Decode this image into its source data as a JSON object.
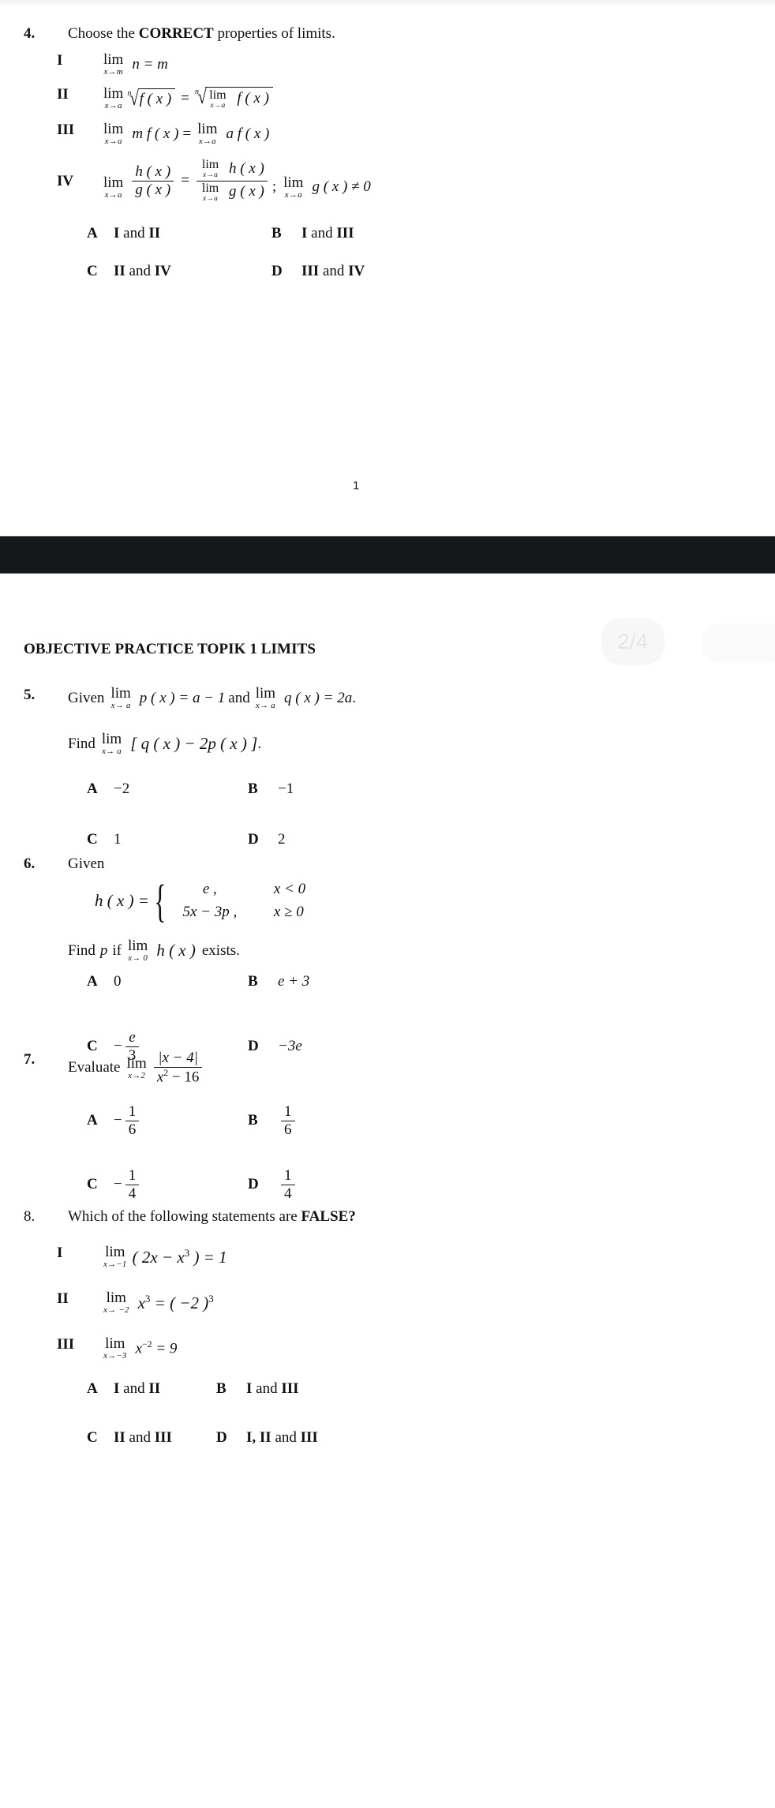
{
  "document": {
    "title": "OBJECTIVE PRACTICE TOPIK 1 LIMITS",
    "page_footer_number": "1"
  },
  "viewer": {
    "page_indicator": "2/4"
  },
  "questions": [
    {
      "number": "4.",
      "prompt_pre": "Choose the ",
      "prompt_bold": "CORRECT",
      "prompt_post": " properties of limits.",
      "statements": [
        {
          "roman": "I",
          "lim_op": "lim",
          "lim_sub": "x→m",
          "body": "n = m"
        },
        {
          "roman": "II",
          "lim_op": "lim",
          "lim_sub": "x→a",
          "root_index": "n",
          "inner": "f ( x )",
          "equals": "=",
          "rhs_root_index": "n",
          "rhs_lim_op": "lim",
          "rhs_lim_sub": "x→a",
          "rhs_inner": "f ( x )"
        },
        {
          "roman": "III",
          "lim_op": "lim",
          "lim_sub": "x→a",
          "lhs": "m f ( x )",
          "equals": "=",
          "rhs_lim_op": "lim",
          "rhs_lim_sub": "x→a",
          "rhs": "a f ( x )"
        },
        {
          "roman": "IV",
          "lim_op": "lim",
          "lim_sub": "x→a",
          "num": "h ( x )",
          "den": "g ( x )",
          "equals": "=",
          "rhs_num_lim": "lim",
          "rhs_num_sub": "x→a",
          "rhs_num": "h ( x )",
          "rhs_den_lim": "lim",
          "rhs_den_sub": "x→a",
          "rhs_den": "g ( x )",
          "semicolon": ";",
          "cond_lim": "lim",
          "cond_sub": "x→a",
          "cond": "g ( x ) ≠ 0"
        }
      ],
      "options": [
        {
          "label": "A",
          "pre": "",
          "bold1": "I",
          "mid": " and ",
          "bold2": "II"
        },
        {
          "label": "B",
          "pre": "",
          "bold1": "I",
          "mid": " and ",
          "bold2": "III"
        },
        {
          "label": "C",
          "pre": "",
          "bold1": "II",
          "mid": " and ",
          "bold2": "IV"
        },
        {
          "label": "D",
          "pre": "",
          "bold1": "III",
          "mid": " and ",
          "bold2": "IV"
        }
      ]
    },
    {
      "number": "5.",
      "given_word": "Given",
      "lim1_op": "lim",
      "lim1_sub": "x→ a",
      "expr1": "p ( x ) = a − 1",
      "and_word": " and ",
      "lim2_op": "lim",
      "lim2_sub": "x→ a",
      "expr2": "q ( x ) = 2a",
      "period1": ".",
      "find_word": "Find",
      "lim3_op": "lim",
      "lim3_sub": "x→ a",
      "expr3": "[ q ( x ) − 2p ( x ) ]",
      "period2": ".",
      "options": [
        {
          "label": "A",
          "value": "−2"
        },
        {
          "label": "B",
          "value": "−1"
        },
        {
          "label": "C",
          "value": "1"
        },
        {
          "label": "D",
          "value": "2"
        }
      ]
    },
    {
      "number": "6.",
      "given_word": "Given",
      "fn_name": "h ( x ) =",
      "piece_rows": [
        {
          "expr": "e ,",
          "cond": "x < 0"
        },
        {
          "expr": "5x − 3p ,",
          "cond": "x ≥ 0"
        }
      ],
      "find_pre": "Find",
      "find_var": "p",
      "find_mid": "if",
      "lim_op": "lim",
      "lim_sub": "x→ 0",
      "find_fn": "h ( x )",
      "find_post": "exists.",
      "options": [
        {
          "label": "A",
          "value": "0"
        },
        {
          "label": "B",
          "value": "e + 3"
        },
        {
          "label": "C",
          "value": "fraction:-e/3"
        },
        {
          "label": "D",
          "value": "−3e"
        }
      ],
      "option_c_sign": "−",
      "option_c_num": "e",
      "option_c_den": "3"
    },
    {
      "number": "7.",
      "evaluate_word": "Evaluate",
      "lim_op": "lim",
      "lim_sub": "x→2",
      "num": "|x − 4|",
      "den_base": "x",
      "den_exp": "2",
      "den_rest": " − 16",
      "options": [
        {
          "label": "A",
          "sign": "−",
          "num": "1",
          "den": "6"
        },
        {
          "label": "B",
          "sign": "",
          "num": "1",
          "den": "6"
        },
        {
          "label": "C",
          "sign": "−",
          "num": "1",
          "den": "4"
        },
        {
          "label": "D",
          "sign": "",
          "num": "1",
          "den": "4"
        }
      ]
    },
    {
      "number": "8.",
      "prompt_pre": "Which of the following statements are ",
      "prompt_bold": "FALSE?",
      "statements": [
        {
          "roman": "I",
          "lim_op": "lim",
          "lim_sub": "x→−1",
          "body_pre": "( 2x − x",
          "body_exp": "3",
          "body_post": " ) = 1"
        },
        {
          "roman": "II",
          "lim_op": "lim",
          "lim_sub": "x→ −2",
          "body_pre": "x",
          "body_exp": "3",
          "body_mid": " = ( −2 )",
          "body_exp2": "3"
        },
        {
          "roman": "III",
          "lim_op": "lim",
          "lim_sub": "x→−3",
          "body_pre": "x",
          "body_exp": "−2",
          "body_post": " = 9"
        }
      ],
      "options": [
        {
          "label": "A",
          "bold1": "I",
          "mid": " and ",
          "bold2": "II"
        },
        {
          "label": "B",
          "bold1": "I",
          "mid": " and ",
          "bold2": "III"
        },
        {
          "label": "C",
          "bold1": "II",
          "mid": " and ",
          "bold2": "III"
        },
        {
          "label": "D",
          "bold1": "I, II",
          "mid": " and ",
          "bold2": "III"
        }
      ]
    }
  ]
}
